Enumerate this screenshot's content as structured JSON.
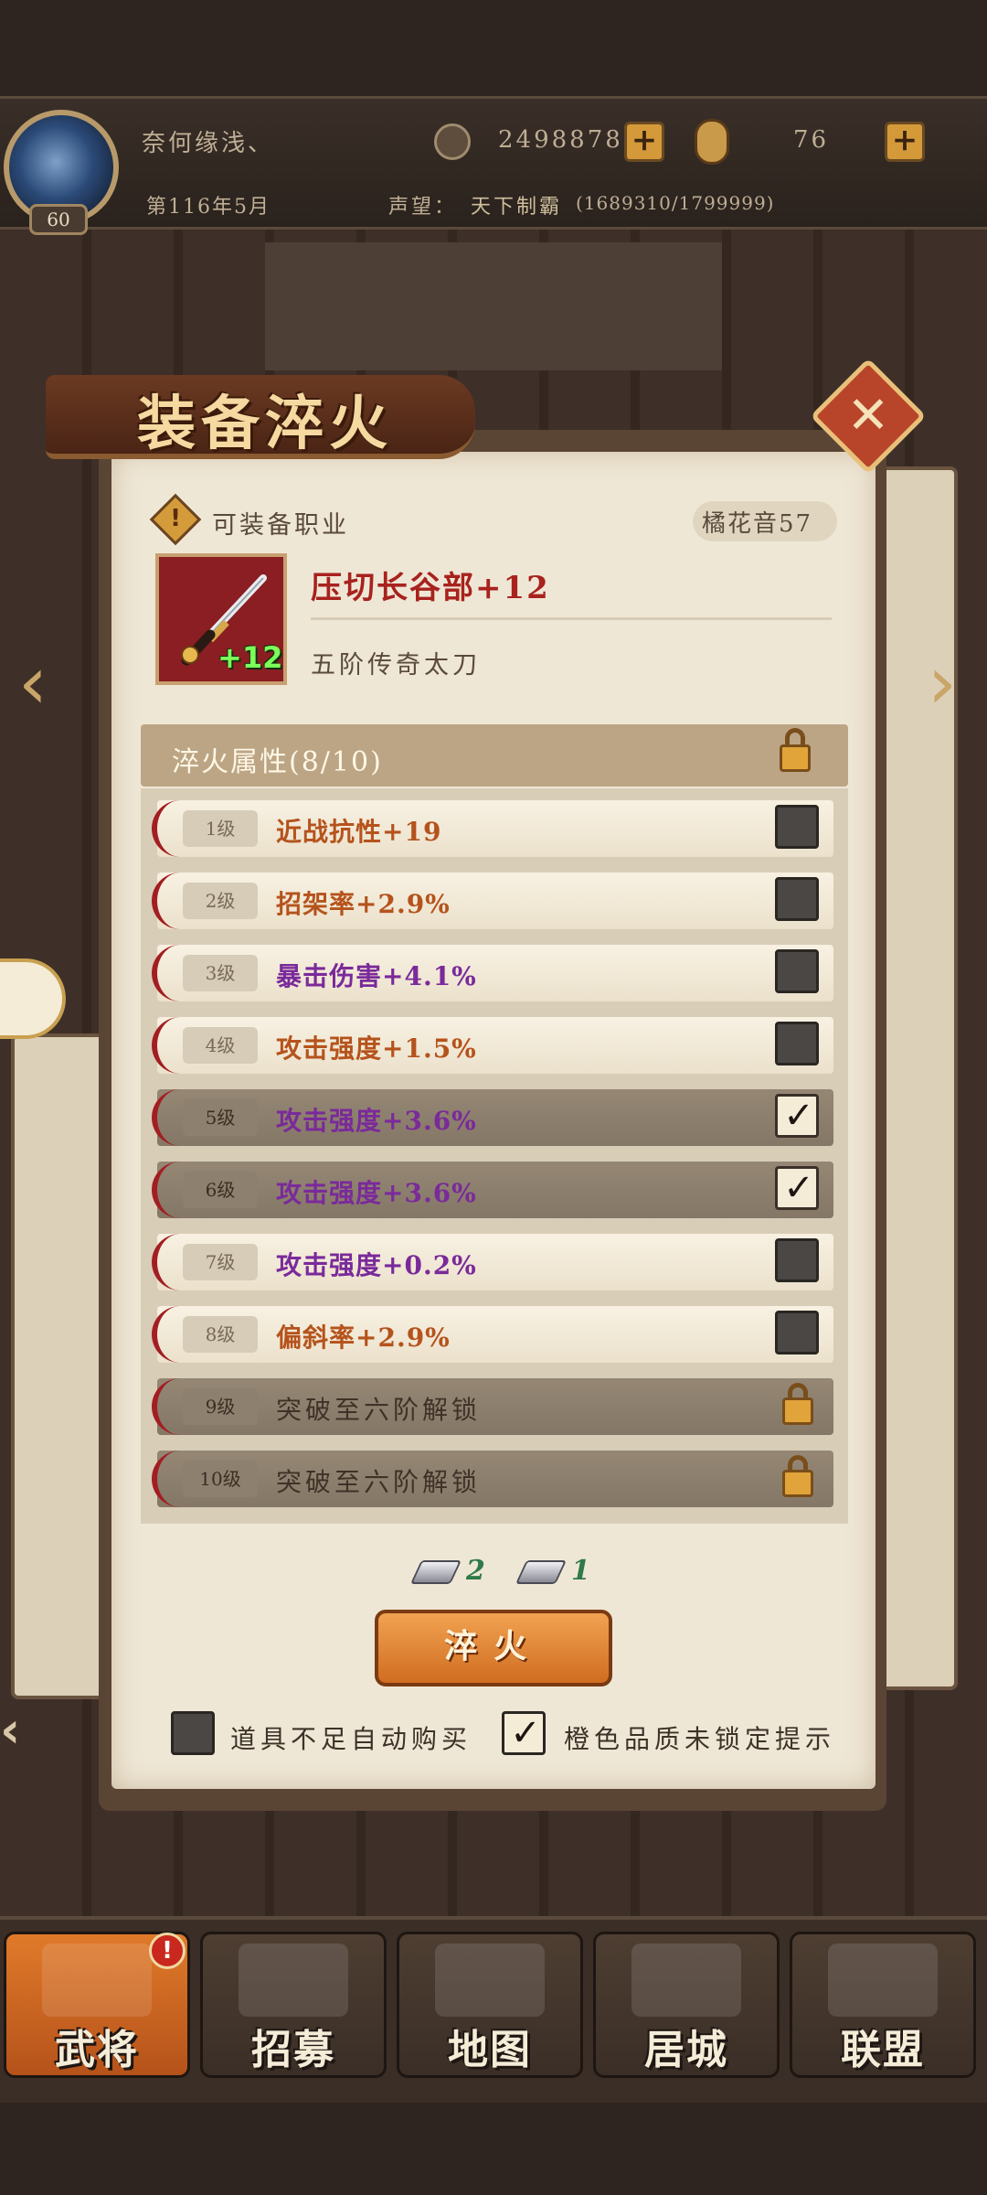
{
  "player": {
    "name": "奈何缘浅、",
    "level": "60",
    "gold": "2498878",
    "bars": "76",
    "date": "第116年5月",
    "fame_label": "声望：",
    "fame_title": "天下制霸",
    "fame_progress": "(1689310/1799999)"
  },
  "dialog": {
    "title": "装备淬火",
    "job_label": "可装备职业",
    "character_tag": "橘花音57",
    "item_name": "压切长谷部+12",
    "item_plus": "+12",
    "item_grade": "五阶传奇太刀",
    "attr_header": "淬火属性(8/10)",
    "attributes": [
      {
        "level": "1级",
        "text": "近战抗性+19",
        "color": "orange",
        "state": "unchecked"
      },
      {
        "level": "2级",
        "text": "招架率+2.9%",
        "color": "orange",
        "state": "unchecked"
      },
      {
        "level": "3级",
        "text": "暴击伤害+4.1%",
        "color": "purple",
        "state": "unchecked"
      },
      {
        "level": "4级",
        "text": "攻击强度+1.5%",
        "color": "orange",
        "state": "unchecked"
      },
      {
        "level": "5级",
        "text": "攻击强度+3.6%",
        "color": "purple",
        "state": "checked"
      },
      {
        "level": "6级",
        "text": "攻击强度+3.6%",
        "color": "purple",
        "state": "checked"
      },
      {
        "level": "7级",
        "text": "攻击强度+0.2%",
        "color": "purple",
        "state": "unchecked"
      },
      {
        "level": "8级",
        "text": "偏斜率+2.9%",
        "color": "orange",
        "state": "unchecked"
      },
      {
        "level": "9级",
        "text": "突破至六阶解锁",
        "color": "locked",
        "state": "locked"
      },
      {
        "level": "10级",
        "text": "突破至六阶解锁",
        "color": "locked",
        "state": "locked"
      }
    ],
    "materials": [
      "2",
      "1"
    ],
    "quench_button": "淬火",
    "option_auto_buy": "道具不足自动购买",
    "option_auto_buy_checked": false,
    "option_orange_hint": "橙色品质未锁定提示",
    "option_orange_hint_checked": true
  },
  "nav": {
    "badge": "!",
    "tabs": [
      "武将",
      "招募",
      "地图",
      "居城",
      "联盟"
    ],
    "active": "武将"
  },
  "colors": {
    "orange_attr": "#b5531c",
    "purple_attr": "#7a2a9a",
    "quench_button": "#e0802c",
    "active_tab": "#d86a24"
  }
}
